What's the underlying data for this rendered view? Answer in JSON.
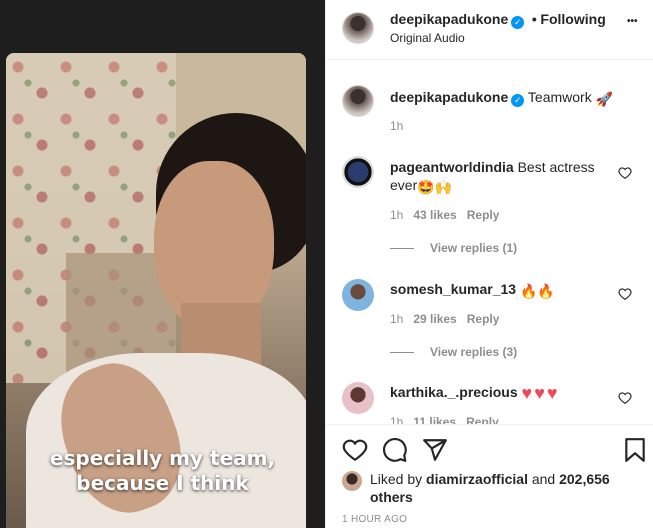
{
  "video": {
    "caption_line1": "especially my team,",
    "caption_line2": "because I think"
  },
  "header": {
    "username": "deepikapadukone",
    "separator": "•",
    "follow_state": "Following",
    "audio": "Original Audio",
    "more": "•••"
  },
  "post": {
    "username": "deepikapadukone",
    "caption": "Teamwork",
    "caption_emoji": "🚀",
    "time": "1h"
  },
  "comments": [
    {
      "username": "pageantworldindia",
      "text": "Best actress ever",
      "emoji": "🤩🙌",
      "time": "1h",
      "likes": "43 likes",
      "reply": "Reply",
      "view_replies": "View replies (1)"
    },
    {
      "username": "somesh_kumar_13",
      "text": "",
      "emoji": "🔥🔥",
      "time": "1h",
      "likes": "29 likes",
      "reply": "Reply",
      "view_replies": "View replies (3)"
    },
    {
      "username": "karthika._.precious",
      "text": "",
      "emoji": "♥♥♥",
      "time": "1h",
      "likes": "11 likes",
      "reply": "Reply"
    }
  ],
  "footer": {
    "liked_by_prefix": "Liked by",
    "liked_by_user": "diamirzaofficial",
    "and": "and",
    "others_count": "202,656 others",
    "timestamp": "1 HOUR AGO"
  },
  "colors": {
    "accent": "#0095f6",
    "heart_red": "#ed4956",
    "text": "#262626",
    "muted": "#8e8e8e"
  }
}
